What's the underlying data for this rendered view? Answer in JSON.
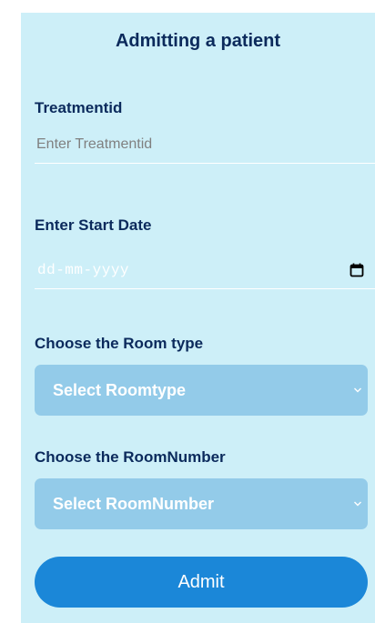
{
  "form": {
    "title": "Admitting a patient",
    "treatment": {
      "label": "Treatmentid",
      "placeholder": "Enter Treatmentid",
      "value": ""
    },
    "start_date": {
      "label": "Enter Start Date",
      "placeholder": "dd-mm-yyyy",
      "icon": "calendar-icon"
    },
    "room_type": {
      "label": "Choose the Room type",
      "selected": "Select Roomtype",
      "icon": "chevron-down-icon"
    },
    "room_number": {
      "label": "Choose the RoomNumber",
      "selected": "Select RoomNumber",
      "icon": "chevron-down-icon"
    },
    "submit_label": "Admit"
  },
  "colors": {
    "panel_background": "#cdeff8",
    "text_dark": "#0b2a5c",
    "select_background": "#93cbe9",
    "button_background": "#1b87d8"
  }
}
